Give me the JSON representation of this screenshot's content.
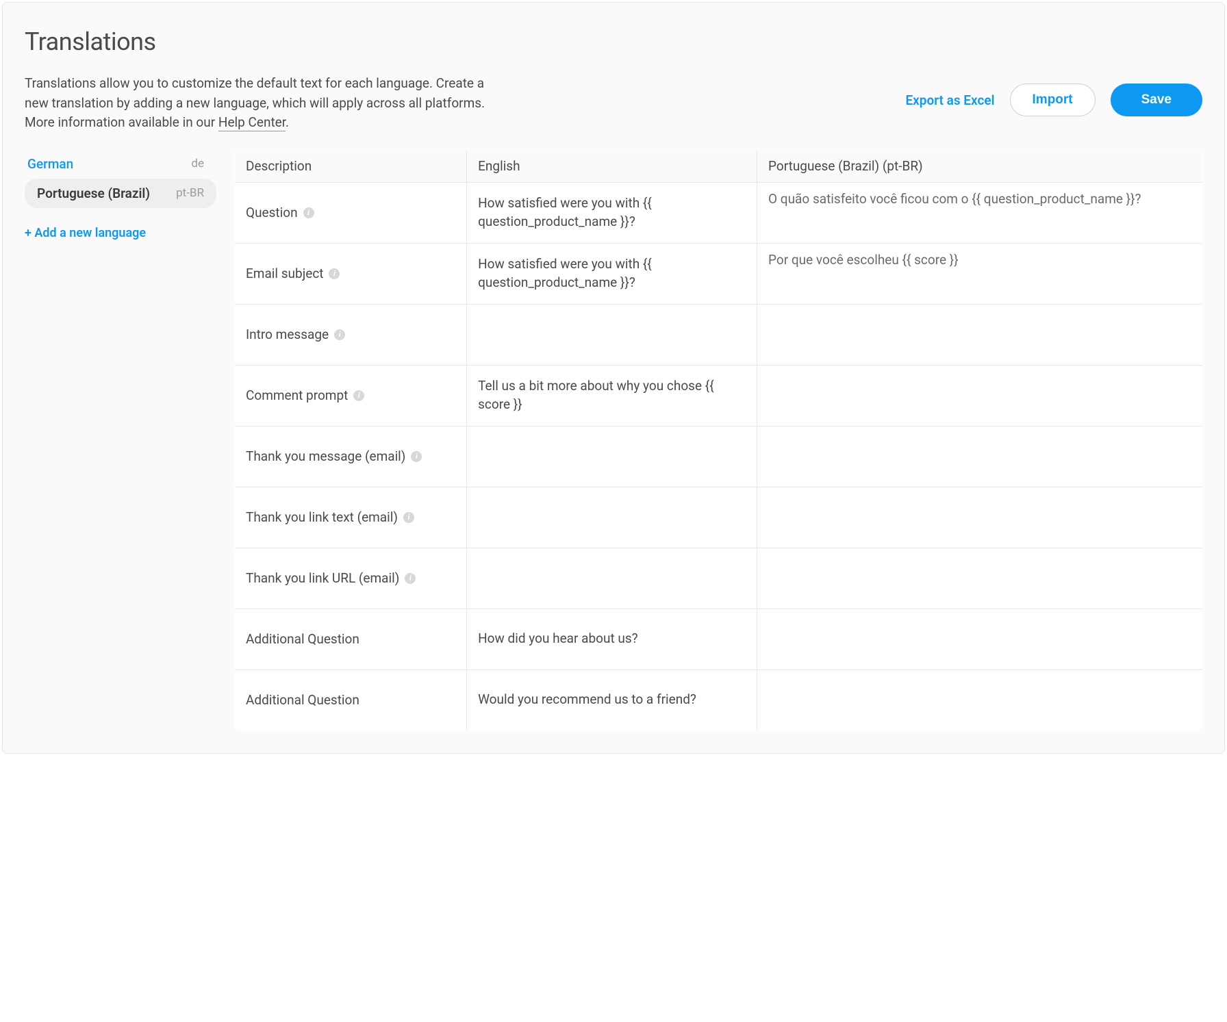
{
  "page": {
    "title": "Translations",
    "description_prefix": "Translations allow you to customize the default text for each language. Create a new translation by adding a new language, which will apply across all platforms. More information available in our ",
    "help_link_label": "Help Center",
    "description_suffix": "."
  },
  "actions": {
    "export_label": "Export as Excel",
    "import_label": "Import",
    "save_label": "Save"
  },
  "sidebar": {
    "languages": [
      {
        "label": "German",
        "code": "de"
      },
      {
        "label": "Portuguese (Brazil)",
        "code": "pt-BR"
      }
    ],
    "add_language_label": "+ Add a new language"
  },
  "table": {
    "columns": {
      "description": "Description",
      "english": "English",
      "translation": "Portuguese (Brazil) (pt-BR)"
    },
    "rows": [
      {
        "description": "Question",
        "has_info": true,
        "english": "How satisfied were you with {{ question_product_name }}?",
        "translation": "O quão satisfeito você ficou com o {{ question_product_name }}?"
      },
      {
        "description": "Email subject",
        "has_info": true,
        "english": "How satisfied were you with {{ question_product_name }}?",
        "translation": "Por que você escolheu {{ score }}"
      },
      {
        "description": "Intro message",
        "has_info": true,
        "english": "",
        "translation": ""
      },
      {
        "description": "Comment prompt",
        "has_info": true,
        "english": "Tell us a bit more about why you chose {{ score }}",
        "translation": ""
      },
      {
        "description": "Thank you message (email)",
        "has_info": true,
        "english": "",
        "translation": ""
      },
      {
        "description": "Thank you link text (email)",
        "has_info": true,
        "english": "",
        "translation": ""
      },
      {
        "description": "Thank you link URL (email)",
        "has_info": true,
        "english": "",
        "translation": ""
      },
      {
        "description": "Additional Question",
        "has_info": false,
        "english": "How did you hear about us?",
        "translation": ""
      },
      {
        "description": "Additional Question",
        "has_info": false,
        "english": "Would you recommend us to a friend?",
        "translation": ""
      }
    ]
  }
}
